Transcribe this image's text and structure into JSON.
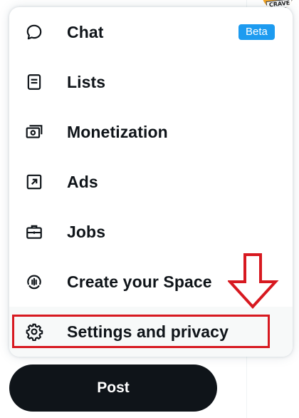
{
  "menu": {
    "items": [
      {
        "label": "Chat",
        "icon": "chat-bubble-icon",
        "badge": "Beta"
      },
      {
        "label": "Lists",
        "icon": "list-document-icon"
      },
      {
        "label": "Monetization",
        "icon": "money-icon"
      },
      {
        "label": "Ads",
        "icon": "external-arrow-icon"
      },
      {
        "label": "Jobs",
        "icon": "briefcase-icon"
      },
      {
        "label": "Create your Space",
        "icon": "microphone-space-icon"
      },
      {
        "label": "Settings and privacy",
        "icon": "gear-icon"
      }
    ]
  },
  "post_button": {
    "label": "Post"
  },
  "avatar": {
    "tag": "CRAVE"
  },
  "colors": {
    "badge": "#1d9bf0",
    "annotation": "#d71920",
    "post_bg": "#0f1419"
  }
}
